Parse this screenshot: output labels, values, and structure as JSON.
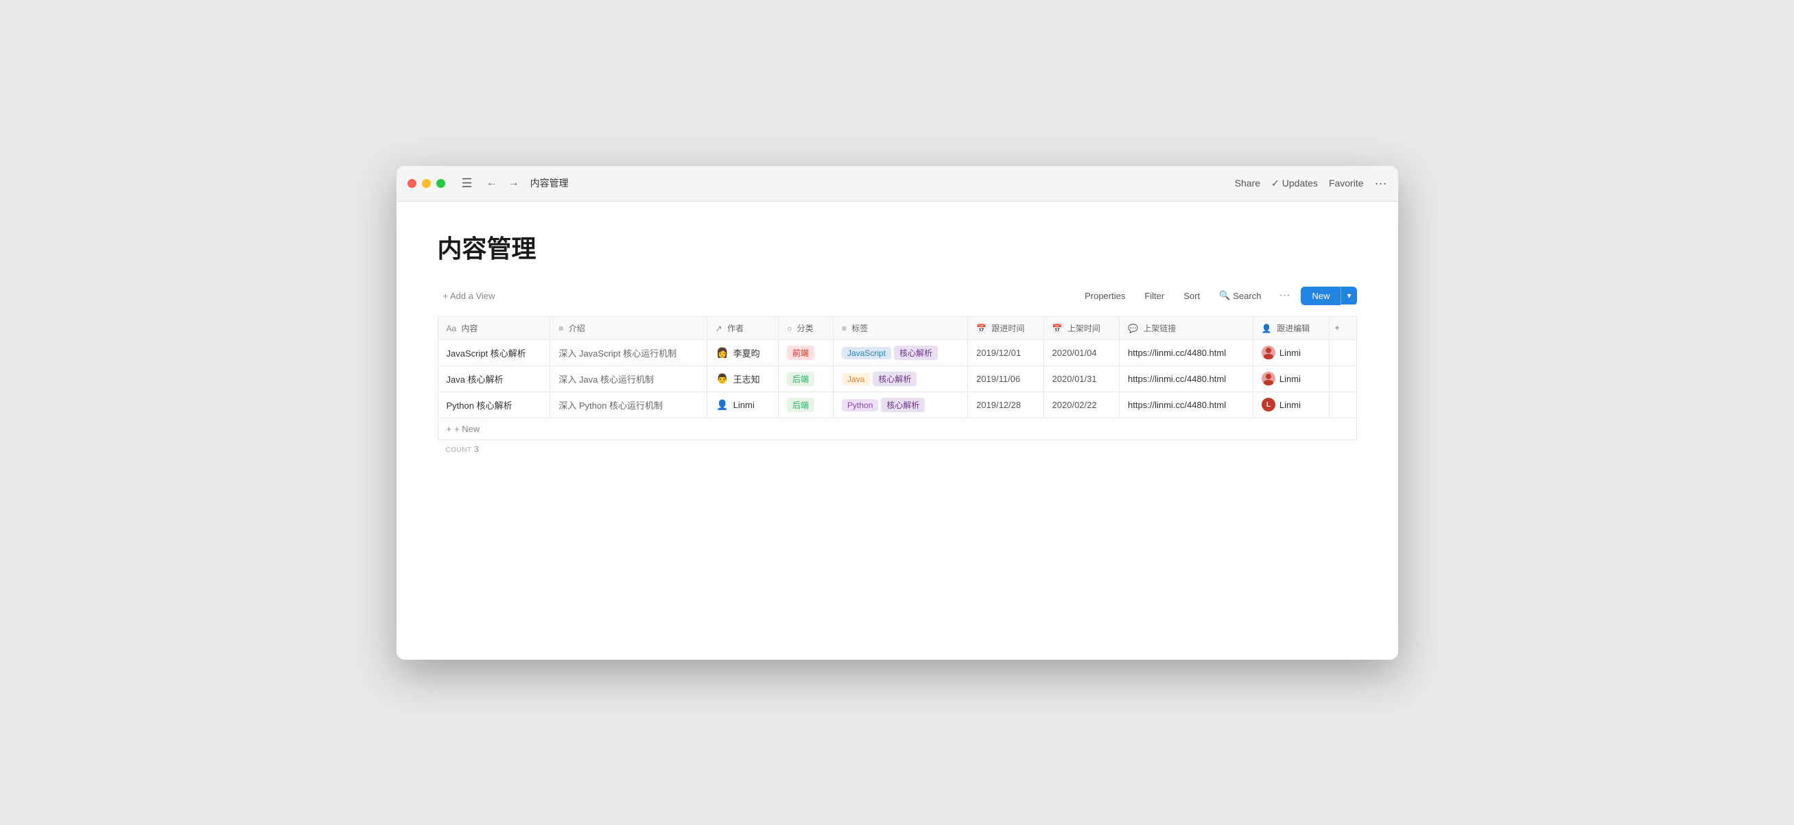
{
  "window": {
    "title": "内容管理"
  },
  "titlebar": {
    "hamburger": "☰",
    "back": "←",
    "forward": "→",
    "title": "内容管理",
    "share": "Share",
    "updates_check": "✓",
    "updates": "Updates",
    "favorite": "Favorite",
    "more": "···"
  },
  "toolbar": {
    "add_view": "+ Add a View",
    "properties": "Properties",
    "filter": "Filter",
    "sort": "Sort",
    "search_icon": "🔍",
    "search": "Search",
    "more_options": "···",
    "new": "New",
    "dropdown": "▾"
  },
  "table": {
    "columns": [
      {
        "icon": "Aa",
        "label": "内容"
      },
      {
        "icon": "≡",
        "label": "介绍"
      },
      {
        "icon": "↗",
        "label": "作者"
      },
      {
        "icon": "○",
        "label": "分类"
      },
      {
        "icon": "≡",
        "label": "标签"
      },
      {
        "icon": "📅",
        "label": "跟进时间"
      },
      {
        "icon": "📅",
        "label": "上架时间"
      },
      {
        "icon": "💬",
        "label": "上架链接"
      },
      {
        "icon": "👤",
        "label": "跟进编辑"
      }
    ],
    "rows": [
      {
        "content": "JavaScript 核心解析",
        "intro": "深入 JavaScript 核心运行机制",
        "author_emoji": "👩",
        "author_name": "李夏昀",
        "category": "前端",
        "category_type": "qianduan",
        "tags": [
          {
            "label": "JavaScript",
            "type": "javascript"
          },
          {
            "label": "核心解析",
            "type": "hexin"
          }
        ],
        "follow_date": "2019/12/01",
        "shelf_date": "2020/01/04",
        "link": "https://linmi.cc/4480.html",
        "editor_avatar_type": "img",
        "editor_name": "Linmi"
      },
      {
        "content": "Java 核心解析",
        "intro": "深入 Java 核心运行机制",
        "author_emoji": "👨",
        "author_name": "王志知",
        "category": "后端",
        "category_type": "houduan",
        "tags": [
          {
            "label": "Java",
            "type": "java"
          },
          {
            "label": "核心解析",
            "type": "hexin"
          }
        ],
        "follow_date": "2019/11/06",
        "shelf_date": "2020/01/31",
        "link": "https://linmi.cc/4480.html",
        "editor_avatar_type": "img",
        "editor_name": "Linmi"
      },
      {
        "content": "Python 核心解析",
        "intro": "深入 Python 核心运行机制",
        "author_emoji": "👤",
        "author_name": "Linmi",
        "category": "后端",
        "category_type": "houduan",
        "tags": [
          {
            "label": "Python",
            "type": "python"
          },
          {
            "label": "核心解析",
            "type": "hexin"
          }
        ],
        "follow_date": "2019/12/28",
        "shelf_date": "2020/02/22",
        "link": "https://linmi.cc/4480.html",
        "editor_avatar_type": "letter",
        "editor_name": "Linmi"
      }
    ],
    "new_row_label": "+ New",
    "count_label": "COUNT",
    "count_value": "3"
  }
}
